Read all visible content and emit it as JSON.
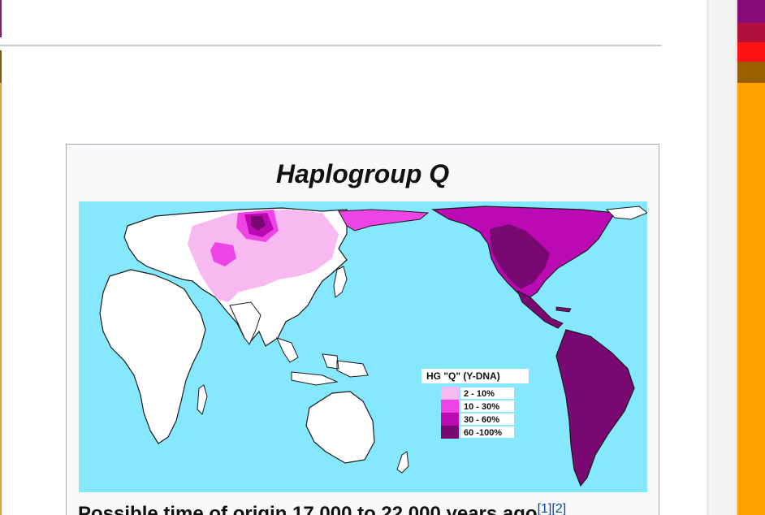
{
  "infobox": {
    "title": "Haplogroup Q",
    "caption": "Possible time of origin  17,000 to 22,000 years ago",
    "citation": "[1][2]"
  },
  "map": {
    "legend": {
      "title": "HG  \"Q\" (Y-DNA)",
      "items": [
        {
          "label": "2  - 10%",
          "color": "#f8b8f0"
        },
        {
          "label": "10 - 30%",
          "color": "#ee44e6"
        },
        {
          "label": "30 - 60%",
          "color": "#bb0ab4"
        },
        {
          "label": "60 -100%",
          "color": "#7a0872"
        }
      ]
    },
    "colors": {
      "ocean": "#86e8ff",
      "land": "#ffffff",
      "outline": "#1a1a1a"
    }
  },
  "right_strip": {
    "colors": [
      "#850a7a",
      "#b0103a",
      "#ff1212",
      "#9a5f00",
      "#ff9f00"
    ]
  }
}
